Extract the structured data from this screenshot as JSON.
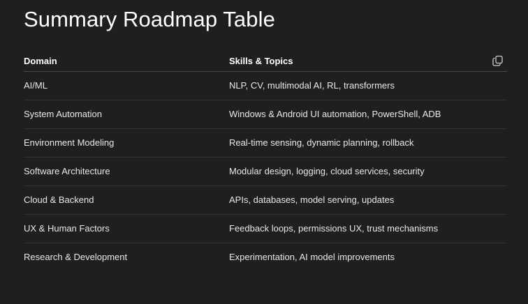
{
  "title": "Summary Roadmap Table",
  "table": {
    "headers": [
      "Domain",
      "Skills & Topics"
    ],
    "rows": [
      [
        "AI/ML",
        "NLP, CV, multimodal AI, RL, transformers"
      ],
      [
        "System Automation",
        "Windows & Android UI automation, PowerShell, ADB"
      ],
      [
        "Environment Modeling",
        "Real-time sensing, dynamic planning, rollback"
      ],
      [
        "Software Architecture",
        "Modular design, logging, cloud services, security"
      ],
      [
        "Cloud & Backend",
        "APIs, databases, model serving, updates"
      ],
      [
        "UX & Human Factors",
        "Feedback loops, permissions UX, trust mechanisms"
      ],
      [
        "Research & Development",
        "Experimentation, AI model improvements"
      ]
    ],
    "copy_icon": "copy-icon"
  },
  "colors": {
    "background": "#1f1f1f",
    "text": "#e8e8e8",
    "divider": "#333333"
  }
}
